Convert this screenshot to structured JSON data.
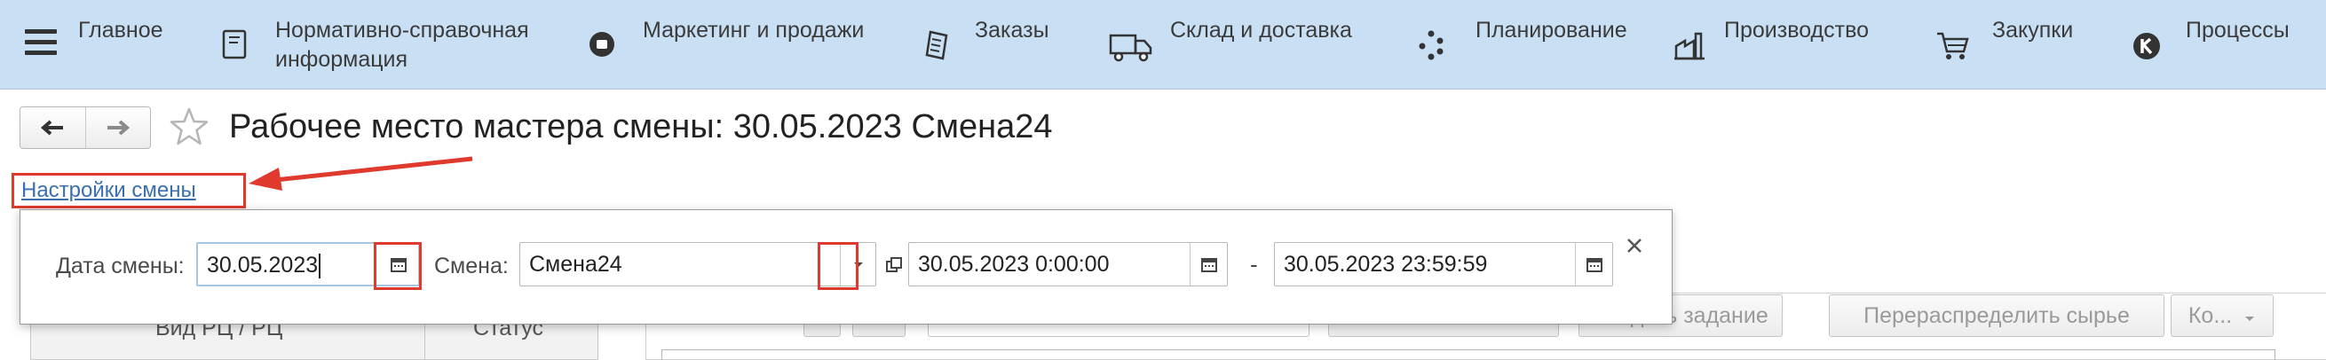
{
  "nav": {
    "items": [
      {
        "label": "Главное",
        "icon": "home-icon"
      },
      {
        "label": "Нормативно-справочная\nинформация",
        "icon": "reference-book-icon"
      },
      {
        "label": "Маркетинг и продажи",
        "icon": "marketing-icon"
      },
      {
        "label": "Заказы",
        "icon": "orders-icon"
      },
      {
        "label": "Склад и доставка",
        "icon": "delivery-truck-icon"
      },
      {
        "label": "Планирование",
        "icon": "planning-icon"
      },
      {
        "label": "Производство",
        "icon": "factory-icon"
      },
      {
        "label": "Закупки",
        "icon": "cart-icon"
      },
      {
        "label": "Процессы",
        "icon": "processes-icon"
      }
    ]
  },
  "page": {
    "title": "Рабочее место мастера смены: 30.05.2023 Смена24",
    "settings_link": "Настройки смены"
  },
  "popup": {
    "date_label": "Дата смены:",
    "date_value": "30.05.2023",
    "shift_label": "Смена:",
    "shift_value": "Смена24",
    "start_value": "30.05.2023  0:00:00",
    "range_separator": "-",
    "end_value": "30.05.2023 23:59:59"
  },
  "background": {
    "col1_header": "Вид РЦ / РЦ",
    "col2_header": "Статус",
    "buttons": {
      "task": "Создать задание",
      "redistribute": "Перераспределить сырье",
      "more": "Ко..."
    }
  },
  "colors": {
    "nav_bg": "#c9dff3",
    "highlight": "#e03a2f",
    "link": "#3a6fb0"
  }
}
